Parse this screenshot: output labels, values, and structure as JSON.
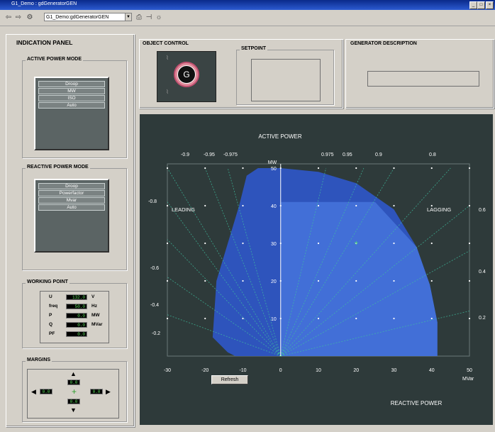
{
  "window": {
    "title": "G1_Demo : gdGeneratorGEN",
    "address": "G1_Demo:gdGeneratorGEN"
  },
  "indication_panel": {
    "title": "INDICATION PANEL",
    "active_power_mode": {
      "title": "ACTIVE POWER MODE",
      "buttons": [
        "Droop",
        "MW",
        "ISO",
        "Auto"
      ]
    },
    "reactive_power_mode": {
      "title": "REACTIVE POWER MODE",
      "buttons": [
        "Droop",
        "Powerfactor",
        "Mvar",
        "Auto"
      ]
    },
    "working_point": {
      "title": "WORKING POINT",
      "rows": [
        {
          "label": "U",
          "value": "132.0",
          "unit": "V"
        },
        {
          "label": "freq",
          "value": "50.0",
          "unit": "Hz"
        },
        {
          "label": "P",
          "value": "0.0",
          "unit": "MW"
        },
        {
          "label": "Q",
          "value": "0.0",
          "unit": "MVar"
        },
        {
          "label": "PF",
          "value": "0.0",
          "unit": ""
        }
      ]
    },
    "margins": {
      "title": "MARGINS",
      "top": "0.0",
      "bottom": "0.0",
      "left": "0.0",
      "right": "0.0"
    }
  },
  "object_control": {
    "title": "OBJECT CONTROL",
    "generator_symbol": "G"
  },
  "setpoint": {
    "title": "SETPOINT"
  },
  "generator_description": {
    "title": "GENERATOR DESCRIPTION"
  },
  "refresh_label": "Refresh",
  "colors": {
    "chart_bg": "#2e3a3a",
    "region_blue": "#2f57c8",
    "region_light": "#4a78e0",
    "grid_dot": "#ffffff",
    "pf_line": "#3fc0a0"
  },
  "chart_data": {
    "type": "area",
    "title": "ACTIVE POWER",
    "xlabel": "REACTIVE POWER",
    "x_unit": "MVar",
    "y_unit": "MW",
    "xlim": [
      -30,
      50
    ],
    "ylim": [
      0,
      50
    ],
    "x_ticks": [
      -30,
      -20,
      -10,
      0,
      10,
      20,
      30,
      40,
      50
    ],
    "y_ticks": [
      10,
      20,
      30,
      40,
      50
    ],
    "region_label_left": "LEADING",
    "region_label_right": "LAGGING",
    "capability_curve": [
      [
        -12,
        0
      ],
      [
        -14,
        1
      ],
      [
        -18,
        5
      ],
      [
        -17,
        20
      ],
      [
        -11,
        40
      ],
      [
        -9,
        48
      ],
      [
        -6,
        50
      ],
      [
        0,
        50
      ],
      [
        10,
        49
      ],
      [
        20,
        46
      ],
      [
        30,
        39
      ],
      [
        36,
        29
      ],
      [
        39.5,
        19
      ],
      [
        41.5,
        9
      ],
      [
        41.5,
        0
      ]
    ],
    "highlight_region": [
      [
        0,
        41
      ],
      [
        25,
        41
      ],
      [
        36,
        29
      ],
      [
        39.5,
        19
      ],
      [
        41.5,
        9
      ],
      [
        41.5,
        0
      ],
      [
        0,
        0
      ]
    ],
    "powerfactor_top_left": [
      "-0.9",
      "-0.95",
      "-0.975"
    ],
    "powerfactor_top_right": [
      "0.975",
      "0.95",
      "0.9",
      "0.8"
    ],
    "powerfactor_side_left": [
      "-0.8",
      "-0.6",
      "-0.4",
      "-0.2"
    ],
    "powerfactor_side_right": [
      "0.6",
      "0.4",
      "0.2"
    ],
    "operating_point": [
      20,
      30
    ],
    "grid": true
  }
}
